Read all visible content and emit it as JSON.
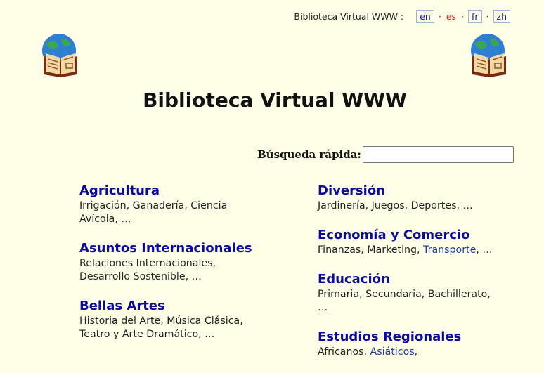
{
  "header": {
    "site_label": "Biblioteca Virtual WWW :",
    "languages": [
      {
        "code": "en",
        "active": false
      },
      {
        "code": "es",
        "active": true
      },
      {
        "code": "fr",
        "active": false
      },
      {
        "code": "zh",
        "active": false
      }
    ]
  },
  "page_title": "Biblioteca Virtual WWW",
  "search": {
    "label": "Búsqueda rápida:",
    "value": "",
    "placeholder": ""
  },
  "left_column": [
    {
      "title": "Agricultura",
      "desc": "Irrigación, Ganadería, Ciencia Avícola, …"
    },
    {
      "title": "Asuntos Internacionales",
      "desc": "Relaciones Internacionales, Desarrollo Sostenible, …"
    },
    {
      "title": "Bellas Artes",
      "desc": "Historia del Arte, Música Clásica, Teatro y Arte Dramático, …"
    }
  ],
  "right_column": [
    {
      "title": "Diversión",
      "desc": "Jardinería, Juegos, Deportes, …"
    },
    {
      "title": "Economía y Comercio",
      "desc_before": "Finanzas, Marketing, ",
      "desc_link": "Transporte",
      "desc_after": ", …"
    },
    {
      "title": "Educación",
      "desc": "Primaria, Secundaria, Bachillerato, …"
    },
    {
      "title": "Estudios Regionales",
      "desc_before": "Africanos, ",
      "desc_link": "Asiáticos",
      "desc_after": ","
    }
  ],
  "icons": {
    "logo_left": "globe-book-icon",
    "logo_right": "globe-book-icon"
  }
}
